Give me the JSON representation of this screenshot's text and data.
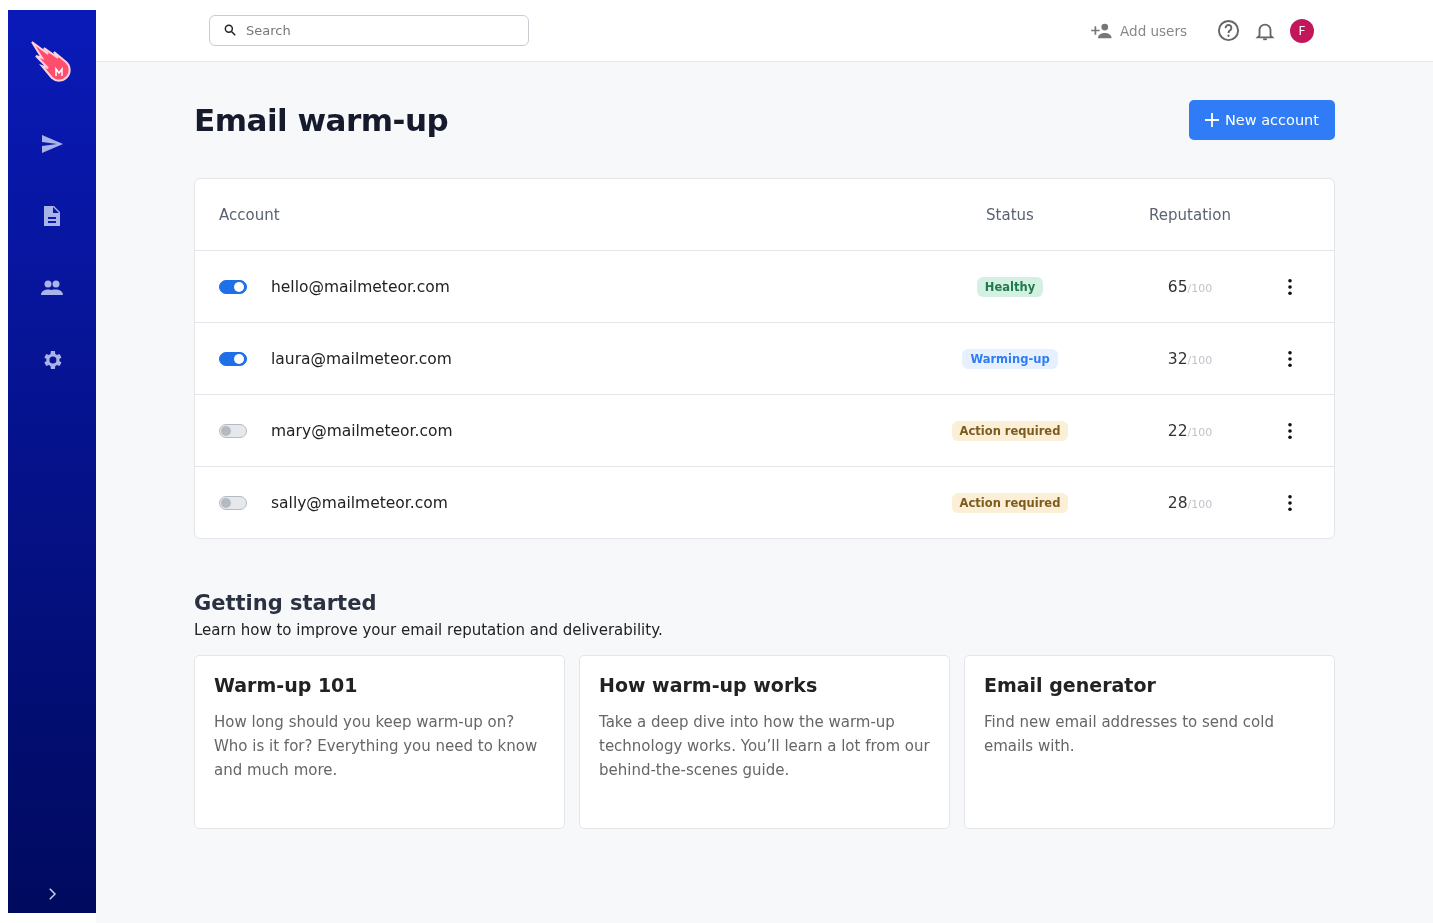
{
  "topbar": {
    "search": {
      "placeholder": "Search"
    },
    "add_users": "Add users",
    "avatar": "F"
  },
  "page": {
    "title": "Email warm-up",
    "new_button": "New account"
  },
  "table": {
    "columns": [
      "Account",
      "Status",
      "Reputation"
    ],
    "rows": [
      {
        "on": true,
        "email": "hello@mailmeteor.com",
        "status": "Healthy",
        "kind": "healthy",
        "score": "65",
        "max": "/100"
      },
      {
        "on": true,
        "email": "laura@mailmeteor.com",
        "status": "Warming-up",
        "kind": "warming",
        "score": "32",
        "max": "/100"
      },
      {
        "on": false,
        "email": "mary@mailmeteor.com",
        "status": "Action required",
        "kind": "action",
        "score": "22",
        "max": "/100"
      },
      {
        "on": false,
        "email": "sally@mailmeteor.com",
        "status": "Action required",
        "kind": "action",
        "score": "28",
        "max": "/100"
      }
    ]
  },
  "getting_started": {
    "title": "Getting started",
    "subtitle": "Learn how to improve your email reputation and deliverability.",
    "cards": [
      {
        "title": "Warm-up 101",
        "text": "How long should you keep warm-up on? Who is it for? Everything you need to know and much more."
      },
      {
        "title": "How warm-up works",
        "text": "Take a deep dive into how the warm-up technology works. You’ll learn a lot from our behind-the-scenes guide."
      },
      {
        "title": "Email generator",
        "text": "Find new email addresses to send cold emails with."
      }
    ]
  }
}
